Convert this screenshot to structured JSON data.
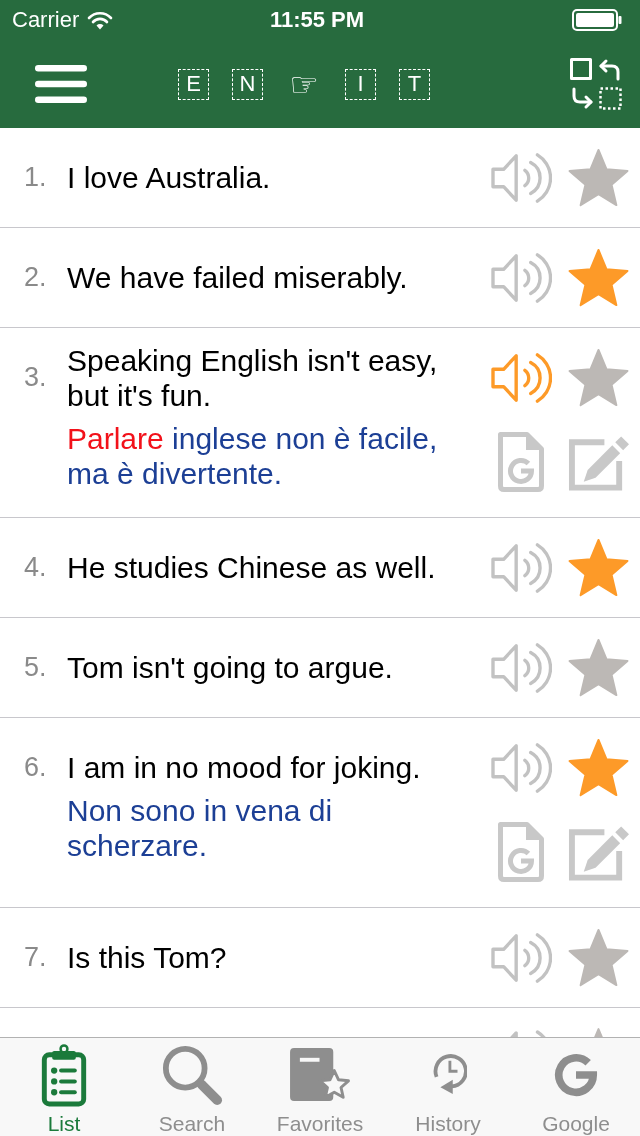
{
  "status_bar": {
    "carrier": "Carrier",
    "time": "11:55 PM"
  },
  "nav_bar": {
    "source_letters": [
      "E",
      "N"
    ],
    "pointer": "☞",
    "target_letters": [
      "I",
      "T"
    ]
  },
  "sentences": [
    {
      "number": "1.",
      "text": "I love Australia.",
      "playing": false,
      "starred": false
    },
    {
      "number": "2.",
      "text": "We have failed miserably.",
      "playing": false,
      "starred": true
    },
    {
      "number": "3.",
      "text": "Speaking English isn't easy, but it's fun.",
      "playing": true,
      "starred": false,
      "translation": [
        {
          "text": "Parlare",
          "highlighted": true
        },
        {
          "text": "inglese non è facile, ma è divertente.",
          "highlighted": false
        }
      ]
    },
    {
      "number": "4.",
      "text": "He studies Chinese as well.",
      "playing": false,
      "starred": true
    },
    {
      "number": "5.",
      "text": "Tom isn't going to argue.",
      "playing": false,
      "starred": false
    },
    {
      "number": "6.",
      "text": "I am in no mood for joking.",
      "playing": false,
      "starred": true,
      "translation": [
        {
          "text": "Non sono in vena di scherzare.",
          "highlighted": false
        }
      ]
    },
    {
      "number": "7.",
      "text": "Is this Tom?",
      "playing": false,
      "starred": false
    }
  ],
  "next_row": {
    "playing": false,
    "starred": false
  },
  "tabs": [
    {
      "label": "List",
      "selected": true
    },
    {
      "label": "Search",
      "selected": false
    },
    {
      "label": "Favorites",
      "selected": false
    },
    {
      "label": "History",
      "selected": false
    },
    {
      "label": "Google",
      "selected": false
    }
  ]
}
